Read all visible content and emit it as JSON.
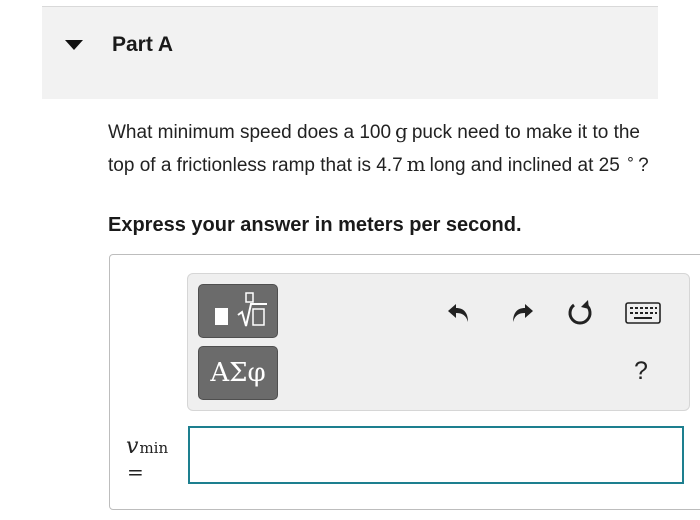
{
  "part": {
    "title": "Part A",
    "collapse_icon": "caret-down-icon"
  },
  "question": {
    "text_1": "What minimum speed does a 100",
    "mass_unit": "g",
    "text_2": "puck need to make it to the top of a frictionless ramp that is 4.7",
    "length_unit": "m",
    "text_3": "long and inclined at 25",
    "degree_symbol": "∘",
    "text_4": "?"
  },
  "instruction": "Express your answer in meters per second.",
  "toolbar": {
    "templates_icon": "templates-sqrt-icon",
    "symbols_label": "ΑΣφ",
    "undo_icon": "undo-icon",
    "redo_icon": "redo-icon",
    "reset_icon": "reset-icon",
    "keyboard_icon": "keyboard-icon",
    "help_label": "?"
  },
  "answer": {
    "variable": "v",
    "subscript": "min",
    "equals": "=",
    "value": "",
    "focus_color": "#1d7f8f"
  }
}
